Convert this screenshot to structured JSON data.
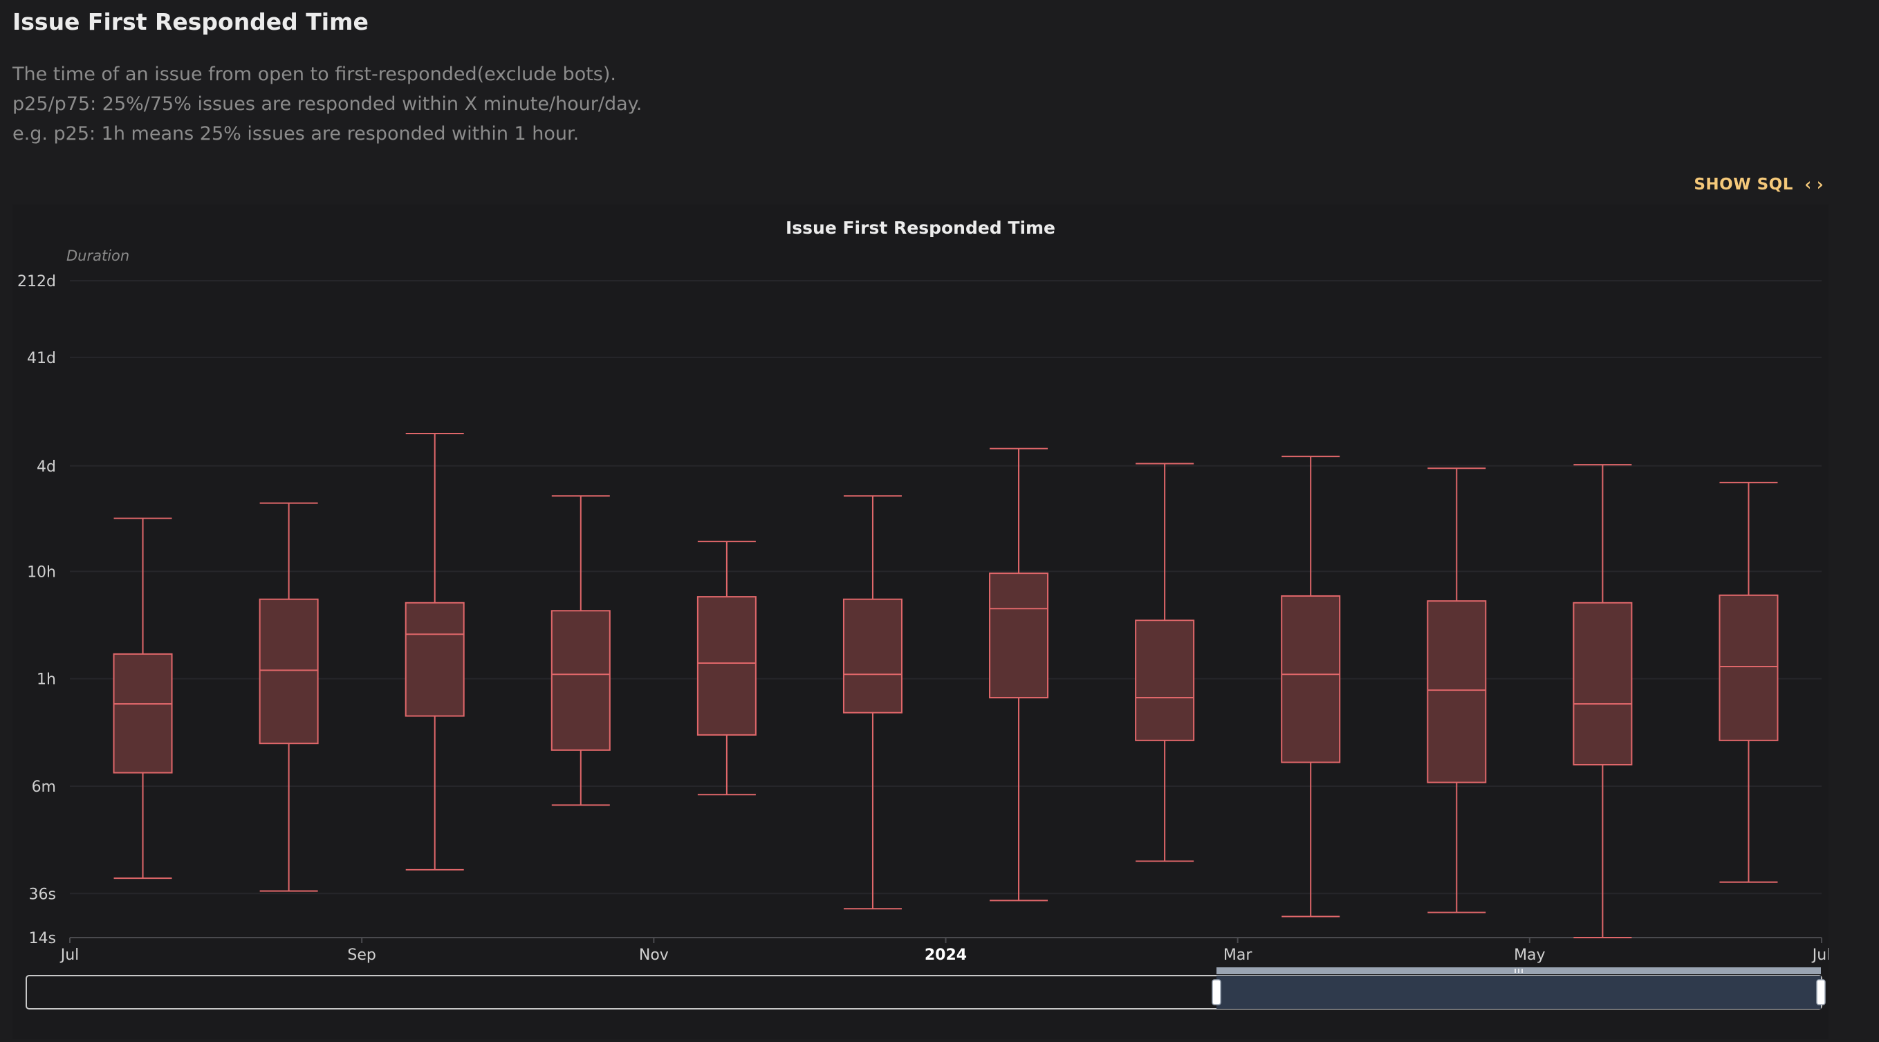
{
  "page": {
    "title": "Issue First Responded Time",
    "description": [
      "The time of an issue from open to first-responded(exclude bots).",
      "p25/p75: 25%/75% issues are responded within X minute/hour/day.",
      "e.g. p25: 1h means 25% issues are responded within 1 hour."
    ]
  },
  "toolbar": {
    "show_sql_label": "SHOW SQL",
    "show_sql_icon": "code-brackets-icon"
  },
  "colors": {
    "box_stroke": "#e0676a",
    "box_fill": "#5a3233",
    "grid": "#26262a",
    "zoom_selected": "#2f3a4c",
    "zoom_handle": "#ffffff"
  },
  "chart_data": {
    "type": "boxplot",
    "title": "Issue First Responded Time",
    "ylabel": "Duration",
    "y_scale": "log",
    "y_ticks": [
      "14s",
      "36s",
      "6m",
      "1h",
      "10h",
      "4d",
      "41d",
      "212d"
    ],
    "x_ticks": [
      "Jul",
      "Sep",
      "Nov",
      "2024",
      "Mar",
      "May",
      "Jul"
    ],
    "x_range": [
      "2023-07",
      "2024-07"
    ],
    "zoom_range": [
      "2023-07",
      "2024-07"
    ],
    "grid": true,
    "series": [
      {
        "values": [
          {
            "x": "2023-07",
            "min": "50s",
            "p25": "8m",
            "median": "35m",
            "p75": "1.7h",
            "max": "1.3d"
          },
          {
            "x": "2023-08",
            "min": "38s",
            "p25": "15m",
            "median": "1.2h",
            "p75": "5.5h",
            "max": "1.8d"
          },
          {
            "x": "2023-09",
            "min": "1m",
            "p25": "27m",
            "median": "2.6h",
            "p75": "5.1h",
            "max": "8d"
          },
          {
            "x": "2023-10",
            "min": "4m",
            "p25": "13m",
            "median": "1.1h",
            "p75": "4.3h",
            "max": "2.1d"
          },
          {
            "x": "2023-11",
            "min": "5m",
            "p25": "18m",
            "median": "1.4h",
            "p75": "5.8h",
            "max": "19h"
          },
          {
            "x": "2023-12",
            "min": "26s",
            "p25": "29m",
            "median": "1.1h",
            "p75": "5.5h",
            "max": "2.1d"
          },
          {
            "x": "2024-01",
            "min": "31s",
            "p25": "40m",
            "median": "4.5h",
            "p75": "9.6h",
            "max": "5.8d"
          },
          {
            "x": "2024-02",
            "min": "1.2m",
            "p25": "16m",
            "median": "40m",
            "p75": "3.5h",
            "max": "4.2d"
          },
          {
            "x": "2024-03",
            "min": "22s",
            "p25": "10m",
            "median": "1.1h",
            "p75": "5.9h",
            "max": "4.9d"
          },
          {
            "x": "2024-04",
            "min": "24s",
            "p25": "6.5m",
            "median": "47m",
            "p75": "5.3h",
            "max": "3.8d"
          },
          {
            "x": "2024-05",
            "min": "14s",
            "p25": "9.5m",
            "median": "35m",
            "p75": "5.1h",
            "max": "4.1d"
          },
          {
            "x": "2024-06",
            "min": "46s",
            "p25": "16m",
            "median": "1.3h",
            "p75": "6h",
            "max": "2.8d"
          }
        ]
      }
    ]
  }
}
